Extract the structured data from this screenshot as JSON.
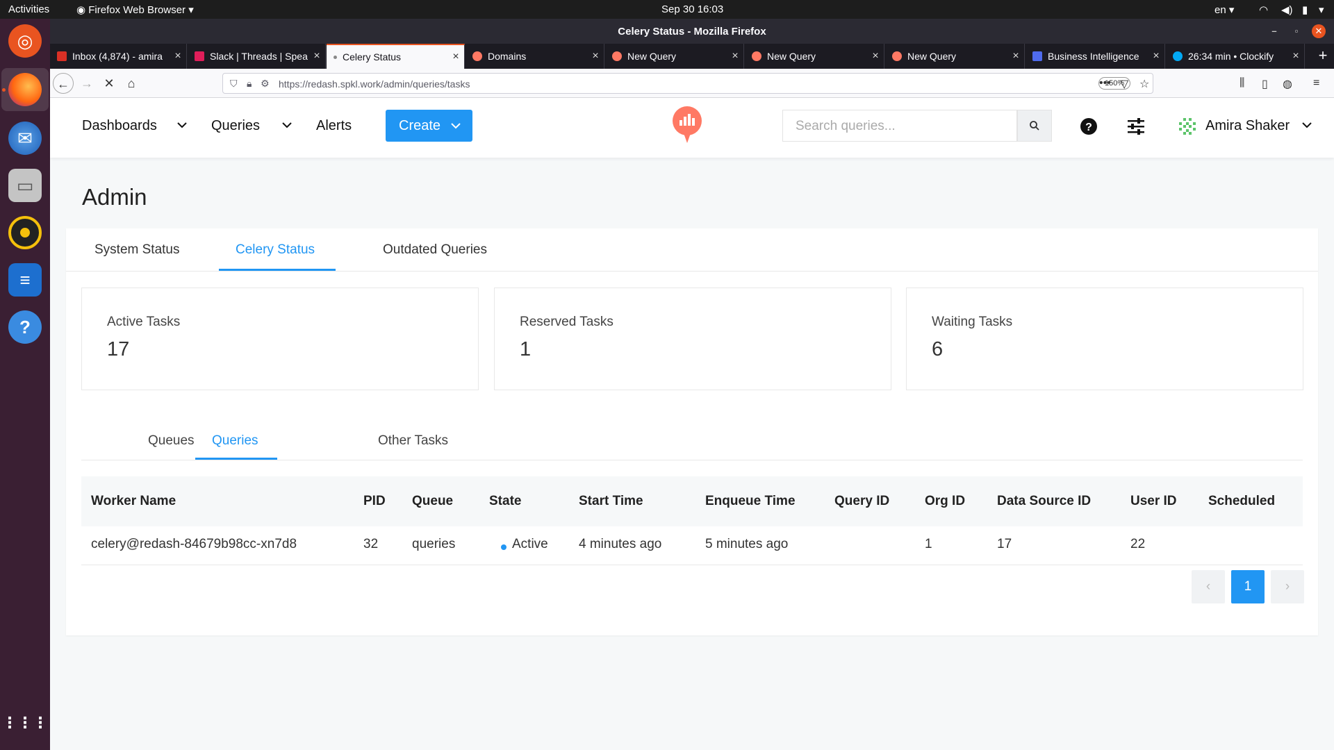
{
  "topbar": {
    "activities": "Activities",
    "app_menu": "Firefox Web Browser",
    "datetime": "Sep 30  16:03",
    "lang": "en"
  },
  "window": {
    "title": "Celery Status - Mozilla Firefox"
  },
  "tabs": [
    {
      "label": "Inbox (4,874) - amira",
      "color": "#d93025"
    },
    {
      "label": "Slack | Threads | Spea",
      "color": "#e01e5a"
    },
    {
      "label": "Celery Status",
      "color": "#888888"
    },
    {
      "label": "Domains",
      "color": "#ff7964"
    },
    {
      "label": "New Query",
      "color": "#ff7964"
    },
    {
      "label": "New Query",
      "color": "#ff7964"
    },
    {
      "label": "New Query",
      "color": "#ff7964"
    },
    {
      "label": "Business Intelligence",
      "color": "#4f6bed"
    },
    {
      "label": "26:34 min • Clockify",
      "color": "#03a9f4"
    }
  ],
  "navbar": {
    "url": "https://redash.spkl.work/admin/queries/tasks",
    "zoom": "150%"
  },
  "header": {
    "dashboards": "Dashboards",
    "queries": "Queries",
    "alerts": "Alerts",
    "create": "Create",
    "search_placeholder": "Search queries...",
    "user_name": "Amira Shaker"
  },
  "page": {
    "title": "Admin"
  },
  "admin_tabs": [
    "System Status",
    "Celery Status",
    "Outdated Queries"
  ],
  "counters": [
    {
      "label": "Active Tasks",
      "value": "17"
    },
    {
      "label": "Reserved Tasks",
      "value": "1"
    },
    {
      "label": "Waiting Tasks",
      "value": "6"
    }
  ],
  "sub_tabs": [
    "Queues",
    "Queries",
    "Other Tasks"
  ],
  "table": {
    "columns": [
      "Worker Name",
      "PID",
      "Queue",
      "State",
      "Start Time",
      "Enqueue Time",
      "Query ID",
      "Org ID",
      "Data Source ID",
      "User ID",
      "Scheduled"
    ],
    "rows": [
      [
        "celery@redash-84679b98cc-xn7d8",
        "32",
        "queries",
        "Active",
        "4 minutes ago",
        "5 minutes ago",
        "",
        "1",
        "17",
        "22",
        ""
      ]
    ]
  },
  "pagination": {
    "prev": "‹",
    "current": "1",
    "next": "›"
  },
  "colors": {
    "accent": "#2196f3",
    "redash_brand": "#ff7964",
    "ubuntu_orange": "#e95420"
  }
}
